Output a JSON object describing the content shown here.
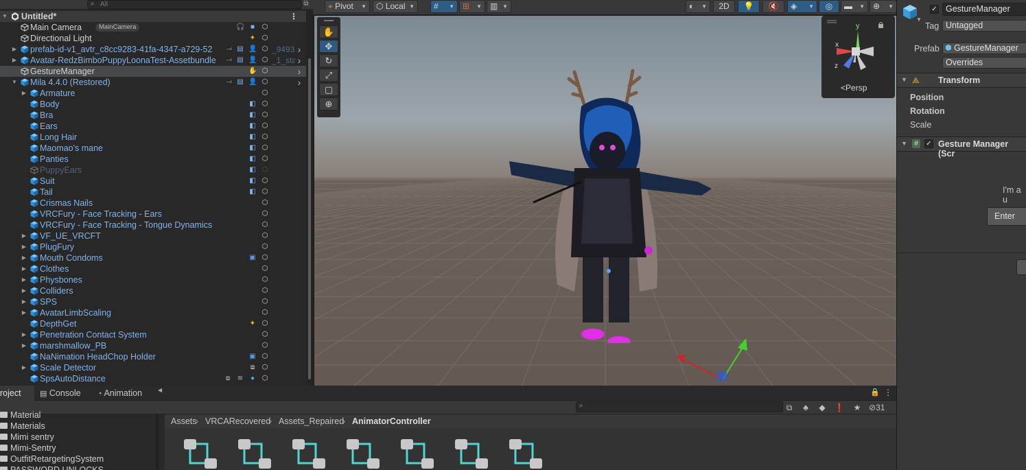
{
  "hierarchy": {
    "search_placeholder": "All",
    "rows": [
      {
        "label": "Untitled*",
        "depth": 0,
        "color": "white",
        "scene": true
      },
      {
        "label": "Main Camera",
        "depth": 1,
        "color": "white",
        "badge": "MainCamera"
      },
      {
        "label": "Directional Light",
        "depth": 1,
        "color": "white"
      },
      {
        "label": "prefab-id-v1_avtr_c8cc9283-41fa-4347-a729-52",
        "depth": 1,
        "color": "blue",
        "arrow": true,
        "suffix": "_9493"
      },
      {
        "label": "Avatar-RedzBimboPuppyLoonaTest-Assetbundle",
        "depth": 1,
        "color": "blue",
        "arrow": true,
        "suffix": "_1_sta"
      },
      {
        "label": "GestureManager",
        "depth": 1,
        "color": "white",
        "selected": true
      },
      {
        "label": "Mila 4.4.0 (Restored)",
        "depth": 1,
        "color": "blue",
        "expanded": true
      },
      {
        "label": "Armature",
        "depth": 2,
        "color": "blue",
        "arrow": true
      },
      {
        "label": "Body",
        "depth": 2,
        "color": "blue"
      },
      {
        "label": "Bra",
        "depth": 2,
        "color": "blue"
      },
      {
        "label": "Ears",
        "depth": 2,
        "color": "blue"
      },
      {
        "label": "Long Hair",
        "depth": 2,
        "color": "blue"
      },
      {
        "label": "Maomao's mane",
        "depth": 2,
        "color": "blue"
      },
      {
        "label": "Panties",
        "depth": 2,
        "color": "blue"
      },
      {
        "label": "PuppyEars",
        "depth": 2,
        "color": "dim"
      },
      {
        "label": "Suit",
        "depth": 2,
        "color": "blue"
      },
      {
        "label": "Tail",
        "depth": 2,
        "color": "blue"
      },
      {
        "label": "Crismas Nails",
        "depth": 2,
        "color": "blue"
      },
      {
        "label": "VRCFury - Face Tracking - Ears",
        "depth": 2,
        "color": "blue"
      },
      {
        "label": "VRCFury - Face Tracking - Tongue Dynamics",
        "depth": 2,
        "color": "blue"
      },
      {
        "label": "VF_UE_VRCFT",
        "depth": 2,
        "color": "blue",
        "arrow": true
      },
      {
        "label": "PlugFury",
        "depth": 2,
        "color": "blue",
        "arrow": true
      },
      {
        "label": "Mouth Condoms",
        "depth": 2,
        "color": "blue",
        "arrow": true
      },
      {
        "label": "Clothes",
        "depth": 2,
        "color": "blue",
        "arrow": true
      },
      {
        "label": "Physbones",
        "depth": 2,
        "color": "blue",
        "arrow": true
      },
      {
        "label": "Colliders",
        "depth": 2,
        "color": "blue",
        "arrow": true
      },
      {
        "label": "SPS",
        "depth": 2,
        "color": "blue",
        "arrow": true
      },
      {
        "label": "AvatarLimbScaling",
        "depth": 2,
        "color": "blue",
        "arrow": true
      },
      {
        "label": "DepthGet",
        "depth": 2,
        "color": "blue"
      },
      {
        "label": "Penetration Contact System",
        "depth": 2,
        "color": "blue",
        "arrow": true
      },
      {
        "label": "marshmallow_PB",
        "depth": 2,
        "color": "blue",
        "arrow": true
      },
      {
        "label": "NaNimation HeadChop Holder",
        "depth": 2,
        "color": "blue"
      },
      {
        "label": "Scale Detector",
        "depth": 2,
        "color": "blue",
        "arrow": true
      },
      {
        "label": "SpsAutoDistance",
        "depth": 2,
        "color": "blue"
      }
    ]
  },
  "scene_toolbar": {
    "pivot": "Pivot",
    "local": "Local",
    "mode_2d": "2D"
  },
  "gizmo": {
    "projection": "Persp",
    "axis_y": "y",
    "axis_x": "x",
    "axis_z": "z"
  },
  "inspector": {
    "object_name": "GestureManager",
    "tag_label": "Tag",
    "tag_value": "Untagged",
    "prefab_label": "Prefab",
    "prefab_value": "GestureManager",
    "overrides": "Overrides",
    "transform_title": "Transform",
    "position_label": "Position",
    "rotation_label": "Rotation",
    "scale_label": "Scale",
    "component_title": "Gesture Manager (Scr",
    "body_text": "I'm a u",
    "enter_button": "Enter"
  },
  "bottom": {
    "tabs": [
      "roject",
      "Console",
      "Animation"
    ],
    "hidden_count": "31",
    "folders": [
      "Material",
      "Materials",
      "Mimi sentry",
      "Mimi-Sentry",
      "OutfitRetargetingSystem",
      "PASSWORD UNLOCKS"
    ],
    "breadcrumb": [
      "Assets",
      "VRCARecovered",
      "Assets_Repaired",
      "AnimatorController"
    ],
    "asset_count": 7
  },
  "colors": {
    "selection": "#46484a",
    "prefab_blue": "#7cb4f2",
    "accent": "#2c5d87"
  }
}
